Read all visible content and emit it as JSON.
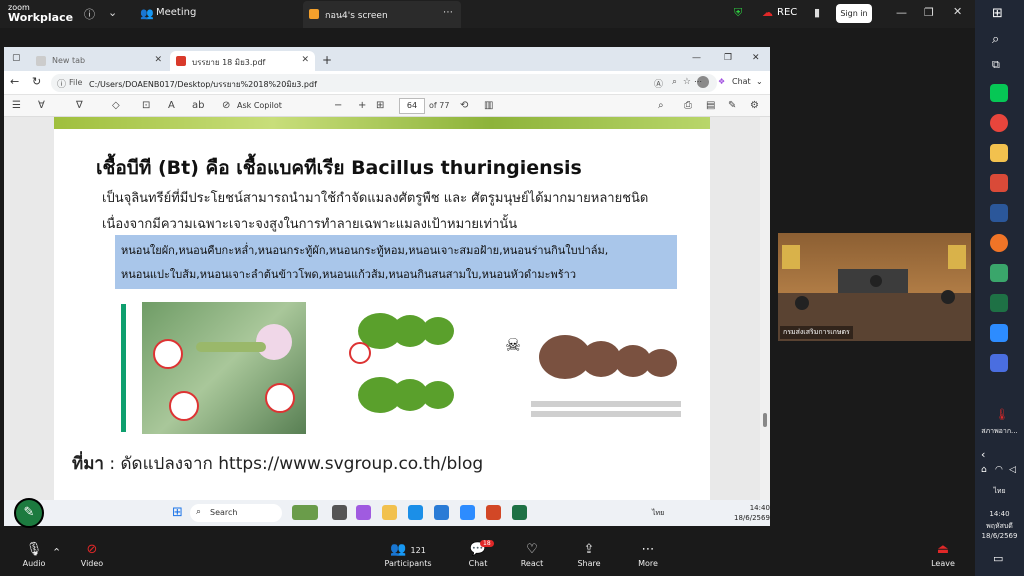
{
  "zoom": {
    "brand_top": "zoom",
    "brand_bottom": "Workplace",
    "meeting_label": "Meeting",
    "share_tab_label": "กอน4's screen",
    "rec_label": "REC",
    "signin_label": "Sign in",
    "controls": {
      "audio": "Audio",
      "video": "Video",
      "participants": "Participants",
      "participants_count": "121",
      "chat": "Chat",
      "chat_badge": "18",
      "react": "React",
      "share": "Share",
      "more": "More",
      "leave": "Leave"
    },
    "video_tile_name": "กรมส่งเสริมการเกษตร"
  },
  "browser": {
    "tabs": [
      {
        "label": "New tab"
      },
      {
        "label": "บรรยาย 18 มิย3.pdf"
      }
    ],
    "url_prefix": "File",
    "url": "C:/Users/DOAENB017/Desktop/บรรยาย%2018%20มิย3.pdf",
    "chat_label": "Chat",
    "pdf_toolbar": {
      "copilot_label": "Ask Copilot",
      "zoom_minus": "−",
      "zoom_plus": "+",
      "page_number": "64",
      "page_total": "of 77"
    }
  },
  "slide": {
    "title": "เชื้อบีที (Bt) คือ เชื้อแบคทีเรีย Bacillus thuringiensis",
    "para_line1": "เป็นจุลินทรีย์ที่มีประโยชน์สามารถนำมาใช้กำจัดแมลงศัตรูพืช และ ศัตรูมนุษย์ได้มากมายหลายชนิด",
    "para_line2": "เนื่องจากมีความเฉพาะเจาะจงสูงในการทำลายเฉพาะแมลงเป้าหมายเท่านั้น",
    "highlight_line1": "หนอนใยผัก,หนอนคืบกะหล่ำ,หนอนกระทู้ผัก,หนอนกระทู้หอม,หนอนเจาะสมอฝ้าย,หนอนร่านกินใบปาล์ม,",
    "highlight_line2": "หนอนแปะใบส้ม,หนอนเจาะลำต้นข้าวโพด,หนอนแก้วส้ม,หนอนกินสนสามใบ,หนอนหัวดำมะพร้าว",
    "source_label": "ที่มา",
    "source_text": ": ดัดแปลงจาก https://www.svgroup.co.th/blog"
  },
  "taskbar": {
    "search_label": "Search",
    "lang": "ไทย",
    "time": "14:40",
    "date": "18/6/2569"
  },
  "windows_side": {
    "weather_label": "สภาพอาก...",
    "lang": "ไทย",
    "time": "14:40",
    "day": "พฤหัสบดี",
    "date": "18/6/2569"
  }
}
